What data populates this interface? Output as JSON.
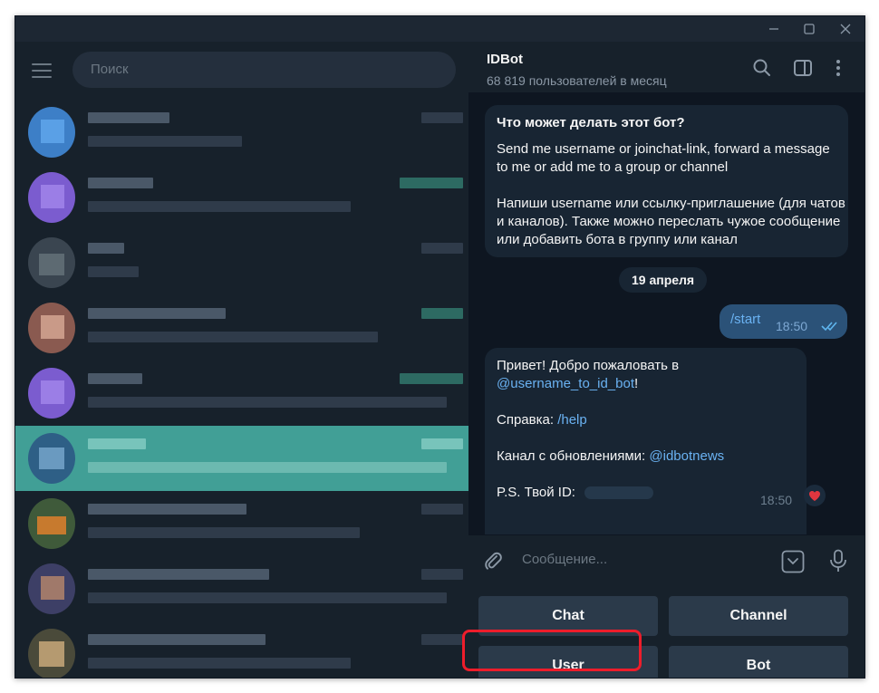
{
  "search": {
    "placeholder": "Поиск"
  },
  "chat_header": {
    "title": "IDBot",
    "subtitle": "68 819 пользователей в месяц"
  },
  "messages": {
    "bot_intro": {
      "heading": "Что может делать этот бот?",
      "para_en": "Send me username or joinchat-link, forward a message to me or add me to a group or channel",
      "para_ru": "Напиши username или ссылку-приглашение (для чатов и каналов). Также можно переслать чужое сообщение или добавить бота в группу или канал"
    },
    "date_separator": "19 апреля",
    "outgoing": {
      "text": "/start",
      "time": "18:50"
    },
    "reply": {
      "line1": "Привет! Добро пожаловать в",
      "mention": "@username_to_id_bot",
      "mention_suffix": "!",
      "help_label": "Справка: ",
      "help_link": "/help",
      "channel_label": "Канал с обновлениями: ",
      "channel_link": "@idbotnews",
      "id_label": "P.S. Твой ID:",
      "time": "18:50"
    }
  },
  "composer": {
    "placeholder": "Сообщение..."
  },
  "keyboard": {
    "chat": "Chat",
    "channel": "Channel",
    "user": "User",
    "bot": "Bot"
  },
  "colors": {
    "accent": "#419f96",
    "link": "#6ab2f2",
    "highlight": "#ee1d2b"
  }
}
